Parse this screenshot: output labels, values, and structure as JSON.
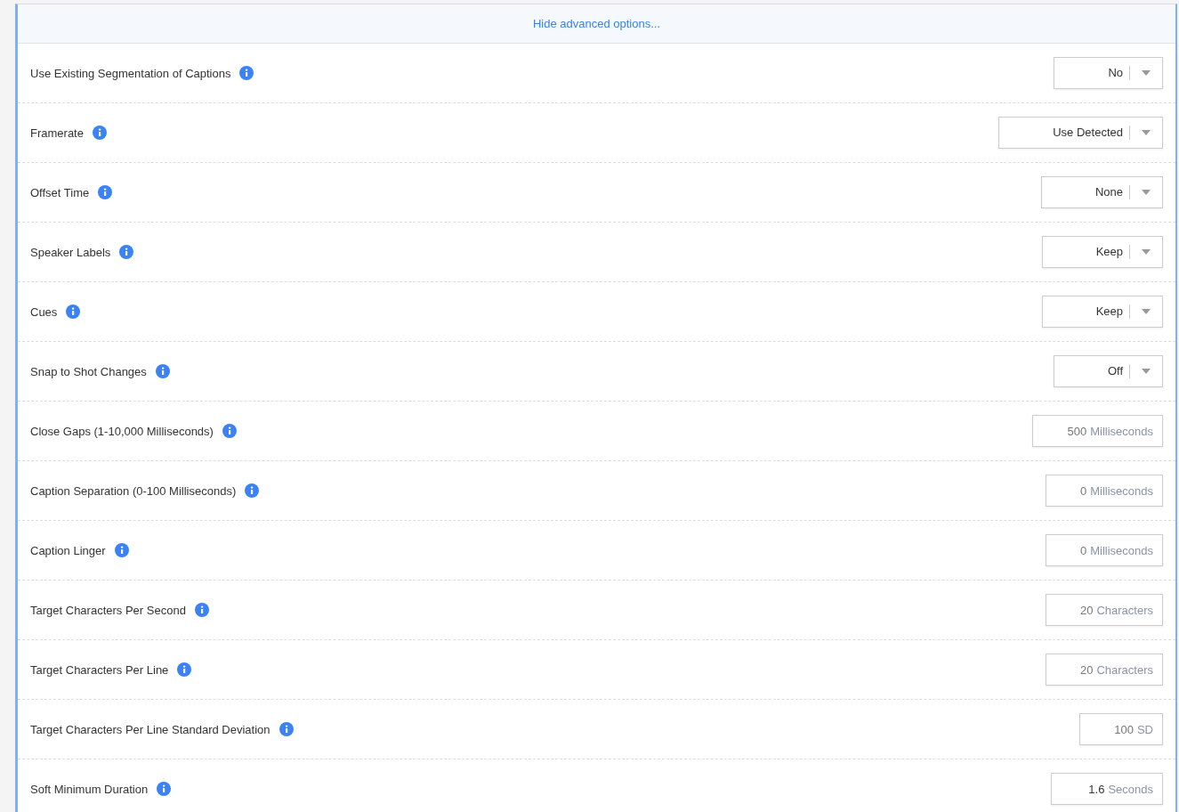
{
  "toggle_link": "Hide advanced options...",
  "settings": [
    {
      "kind": "select",
      "label": "Use Existing Segmentation of Captions",
      "value": "No"
    },
    {
      "kind": "select",
      "label": "Framerate",
      "value": "Use Detected"
    },
    {
      "kind": "select",
      "label": "Offset Time",
      "value": "None"
    },
    {
      "kind": "select",
      "label": "Speaker Labels",
      "value": "Keep"
    },
    {
      "kind": "select",
      "label": "Cues",
      "value": "Keep"
    },
    {
      "kind": "select",
      "label": "Snap to Shot Changes",
      "value": "Off"
    },
    {
      "kind": "number",
      "label": "Close Gaps (1-10,000 Milliseconds)",
      "placeholder": "500",
      "unit": "Milliseconds"
    },
    {
      "kind": "number",
      "label": "Caption Separation (0-100 Milliseconds)",
      "placeholder": "0",
      "unit": "Milliseconds"
    },
    {
      "kind": "number",
      "label": "Caption Linger",
      "placeholder": "0",
      "unit": "Milliseconds"
    },
    {
      "kind": "number",
      "label": "Target Characters Per Second",
      "placeholder": "20",
      "unit": "Characters"
    },
    {
      "kind": "number",
      "label": "Target Characters Per Line",
      "placeholder": "20",
      "unit": "Characters"
    },
    {
      "kind": "number",
      "label": "Target Characters Per Line Standard Deviation",
      "placeholder": "100",
      "unit": "SD"
    },
    {
      "kind": "number",
      "label": "Soft Minimum Duration",
      "value": "1.6",
      "unit": "Seconds"
    }
  ]
}
